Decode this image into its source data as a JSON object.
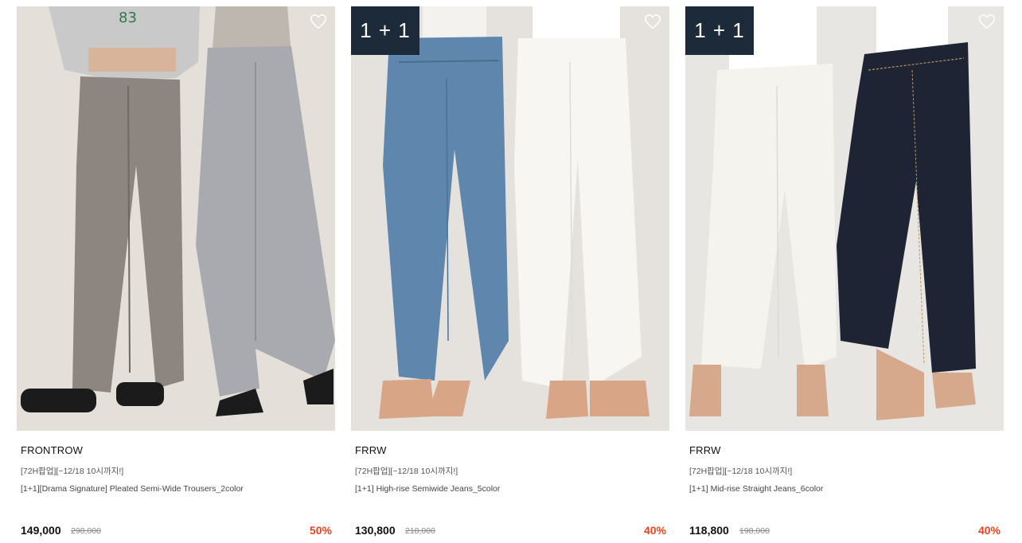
{
  "products": [
    {
      "brand": "FRONTROW",
      "promo": "[72H팝업][~12/18 10시까지!]",
      "title": "[1+1][Drama Signature] Pleated Semi-Wide Trousers_2color",
      "price": "149,000",
      "original_price": "298,000",
      "discount": "50%",
      "badge": "",
      "wishlist_icon": "heart-outline-icon"
    },
    {
      "brand": "FRRW",
      "promo": "[72H팝업][~12/18 10시까지!]",
      "title": "[1+1] High-rise Semiwide Jeans_5color",
      "price": "130,800",
      "original_price": "218,000",
      "discount": "40%",
      "badge": "1 + 1",
      "wishlist_icon": "heart-outline-icon"
    },
    {
      "brand": "FRRW",
      "promo": "[72H팝업][~12/18 10시까지!]",
      "title": "[1+1] Mid-rise Straight Jeans_6color",
      "price": "118,800",
      "original_price": "198,000",
      "discount": "40%",
      "badge": "1 + 1",
      "wishlist_icon": "heart-outline-icon"
    }
  ],
  "colors": {
    "badge_bg": "#1d2a3a",
    "discount": "#e8451f",
    "price": "#111111",
    "muted": "#888888"
  }
}
